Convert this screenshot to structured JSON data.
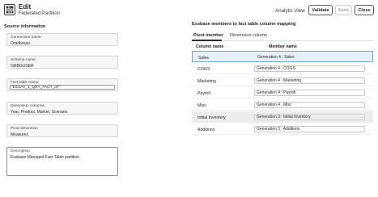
{
  "header": {
    "title": "Edit",
    "subtitle": "Federated Partition",
    "view_label": "Analytic View",
    "validate_label": "Validate",
    "save_label": "Save",
    "close_label": "Close"
  },
  "source": {
    "section_title": "Source information",
    "connection": {
      "label": "Connection name",
      "value": "Oradbrepo"
    },
    "schema": {
      "label": "Schema name",
      "value": "GRBGUSER"
    },
    "fact_table": {
      "label": "Fact table name",
      "value": "\"ESSAV_1_QRY_FACT_dT\""
    },
    "dimension_columns": {
      "label": "Dimension columns",
      "value": "Year, Product, Market, Scenario"
    },
    "pivot_dimension": {
      "label": "Pivot dimension",
      "value": "Measures"
    },
    "description": {
      "label": "Description",
      "value": "Essbase Managed Fact Table partition"
    }
  },
  "mapping": {
    "section_title": "Essbase members to fact table column mapping",
    "tabs": [
      {
        "label": "Pivot member",
        "active": true
      },
      {
        "label": "Dimension column",
        "active": false
      }
    ],
    "columns": [
      "Column name",
      "Member name"
    ],
    "rows": [
      {
        "column": "Sales",
        "member": "Generation 4 : Sales",
        "state": "selected"
      },
      {
        "column": "COGS",
        "member": "Generation 4 : COGS",
        "state": "normal"
      },
      {
        "column": "Marketing",
        "member": "Generation 4 : Marketing",
        "state": "normal"
      },
      {
        "column": "Payroll",
        "member": "Generation 4 : Payroll",
        "state": "normal"
      },
      {
        "column": "Misc",
        "member": "Generation 4 : Misc",
        "state": "normal"
      },
      {
        "column": "Initial Inventory",
        "member": "Generation 3 : Initial Inventory",
        "state": "hover"
      },
      {
        "column": "Additions",
        "member": "Generation 3 : Additions",
        "state": "normal"
      }
    ]
  },
  "icons": {
    "app": "cube-grid-icon"
  },
  "colors": {
    "selected_row": "#e7f0f8",
    "selected_border": "#7aa4c8",
    "hover_row": "#ececec"
  }
}
